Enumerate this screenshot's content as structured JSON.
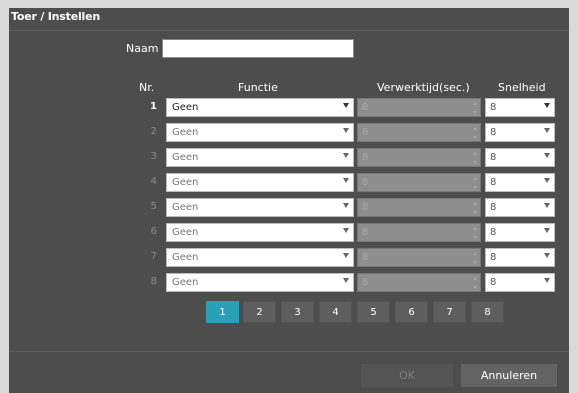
{
  "dialog": {
    "title": "Toer / Instellen"
  },
  "name_field": {
    "label": "Naam",
    "value": ""
  },
  "columns": {
    "nr": "Nr.",
    "function": "Functie",
    "time": "Verwerktijd(sec.)",
    "speed": "Snelheid"
  },
  "rows": [
    {
      "nr": "1",
      "function": "Geen",
      "time": "8",
      "speed": "8",
      "active": true
    },
    {
      "nr": "2",
      "function": "Geen",
      "time": "8",
      "speed": "8",
      "active": false
    },
    {
      "nr": "3",
      "function": "Geen",
      "time": "8",
      "speed": "8",
      "active": false
    },
    {
      "nr": "4",
      "function": "Geen",
      "time": "8",
      "speed": "8",
      "active": false
    },
    {
      "nr": "5",
      "function": "Geen",
      "time": "8",
      "speed": "8",
      "active": false
    },
    {
      "nr": "6",
      "function": "Geen",
      "time": "8",
      "speed": "8",
      "active": false
    },
    {
      "nr": "7",
      "function": "Geen",
      "time": "8",
      "speed": "8",
      "active": false
    },
    {
      "nr": "8",
      "function": "Geen",
      "time": "8",
      "speed": "8",
      "active": false
    }
  ],
  "pagination": {
    "pages": [
      "1",
      "2",
      "3",
      "4",
      "5",
      "6",
      "7",
      "8"
    ],
    "current": "1"
  },
  "buttons": {
    "ok": "OK",
    "cancel": "Annuleren"
  },
  "colors": {
    "dialog_bg": "#4d4d4d",
    "accent": "#2aa0b8",
    "disabled_field": "#8e8e8e"
  }
}
